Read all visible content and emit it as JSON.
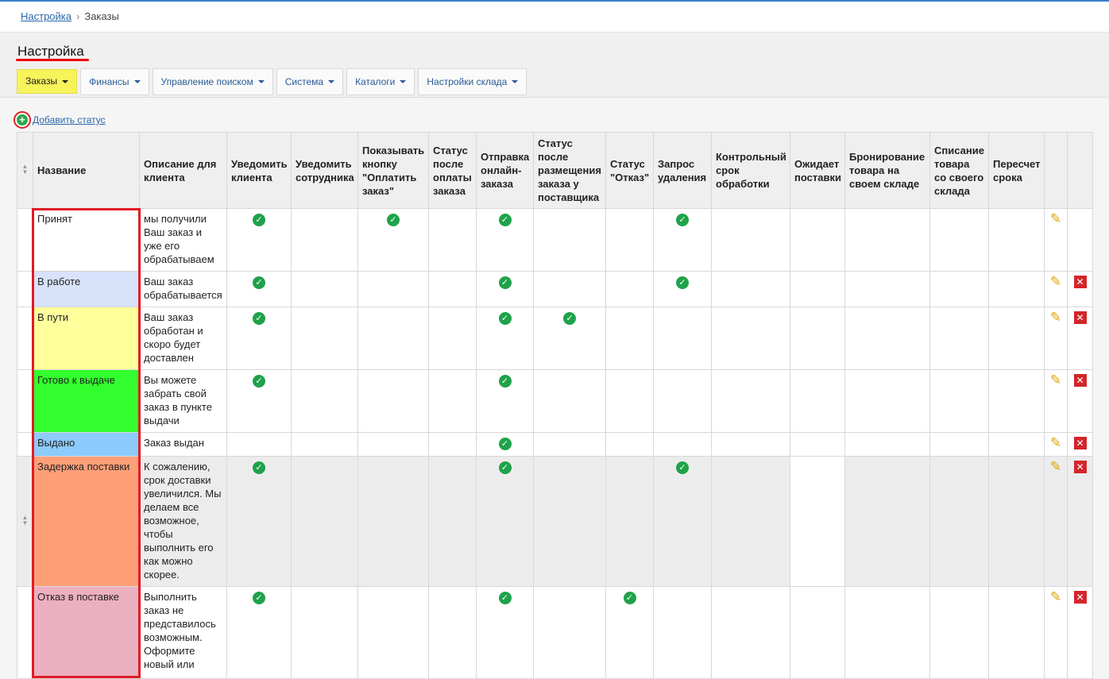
{
  "breadcrumb": {
    "root": "Настройка",
    "current": "Заказы"
  },
  "page": {
    "title": "Настройка"
  },
  "tabs": [
    {
      "label": "Заказы"
    },
    {
      "label": "Финансы"
    },
    {
      "label": "Управление поиском"
    },
    {
      "label": "Система"
    },
    {
      "label": "Каталоги"
    },
    {
      "label": "Настройки склада"
    }
  ],
  "add_status": {
    "label": "Добавить статус"
  },
  "columns": [
    "Название",
    "Описание для клиента",
    "Уведомить клиента",
    "Уведомить сотрудника",
    "Показывать кнопку \"Оплатить заказ\"",
    "Статус после оплаты заказа",
    "Отправка онлайн-заказа",
    "Статус после размещения заказа у поставщика",
    "Статус \"Отказ\"",
    "Запрос удаления",
    "Контрольный срок обработки",
    "Ожидает поставки",
    "Бронирование товара на своем складе",
    "Списание товара со своего склада",
    "Пересчет срока"
  ],
  "colors": {
    "accent": "#2a67a8",
    "highlight_tab": "#f7f35a",
    "check": "#1fa24a",
    "delete": "#d3262b",
    "annotation": "#e01b24"
  },
  "rows": [
    {
      "name": "Принят",
      "desc": "мы получили Ваш заказ и уже его обрабатываем",
      "color": "#ffffff",
      "checks": [
        0,
        2,
        4,
        7
      ],
      "deletable": false
    },
    {
      "name": "В работе",
      "desc": "Ваш заказ обрабатывается",
      "color": "#d9e2fb",
      "checks": [
        0,
        4,
        7
      ],
      "deletable": true
    },
    {
      "name": "В пути",
      "desc": "Ваш заказ обработан и скоро будет доставлен",
      "color": "#ffff9c",
      "checks": [
        0,
        4,
        5
      ],
      "deletable": true
    },
    {
      "name": "Готово к выдаче",
      "desc": "Вы можете забрать свой заказ в пункте выдачи",
      "color": "#33ff2e",
      "checks": [
        0,
        4
      ],
      "deletable": true
    },
    {
      "name": "Выдано",
      "desc": "Заказ выдан",
      "color": "#8ccbfb",
      "checks": [
        4
      ],
      "deletable": true
    },
    {
      "name": "Задержка поставки",
      "desc": "К сожалению, срок доставки увеличился. Мы делаем все возможное, чтобы выполнить его как можно скорее.",
      "color": "#ff9f78",
      "checks": [
        0,
        4,
        7
      ],
      "deletable": true,
      "gray": true
    },
    {
      "name": "Отказ в поставке",
      "desc": "Выполнить заказ не представилось возможным. Оформите новый или",
      "color": "#ecafc0",
      "checks": [
        0,
        4,
        6
      ],
      "deletable": true
    }
  ]
}
